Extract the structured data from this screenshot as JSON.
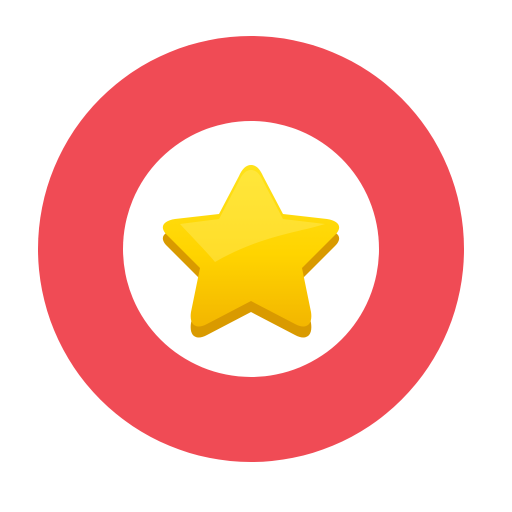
{
  "icon": {
    "name": "star-badge-icon",
    "ring_name": "ring",
    "star_name": "star-icon"
  },
  "colors": {
    "background": "#ffffff",
    "ring": "#f04b55",
    "ring_inner": "#ffffff",
    "star_top": "#ffe21a",
    "star_mid": "#ffd400",
    "star_bottom": "#f3b600",
    "star_edge": "#d99a00",
    "star_highlight": "#fff27a"
  }
}
